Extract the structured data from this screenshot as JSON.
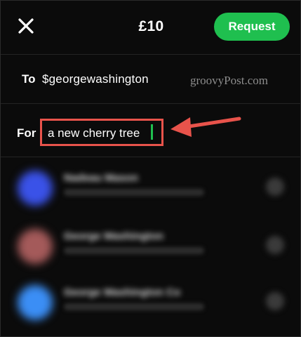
{
  "header": {
    "amount": "£10",
    "request_label": "Request",
    "close_icon": "close-icon"
  },
  "to_row": {
    "label": "To",
    "value": "$georgewashington"
  },
  "watermark": "groovyPost.com",
  "for_row": {
    "label": "For",
    "value": "a new cherry tree"
  },
  "contacts": [
    {
      "name": "Nadeau Mason",
      "avatar_color": "#3a52e8"
    },
    {
      "name": "George Washington",
      "avatar_color": "#a45a5a"
    },
    {
      "name": "George Washington Co",
      "avatar_color": "#3b8ef5"
    }
  ],
  "colors": {
    "accent_green": "#1fbf4f",
    "highlight_red": "#e8534b",
    "background": "#0b0b0b"
  }
}
